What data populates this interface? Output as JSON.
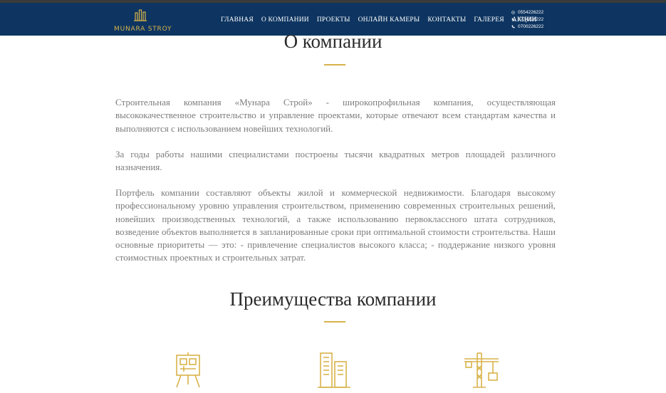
{
  "header": {
    "logo_text": "MUNARA STROY",
    "nav": [
      "ГЛАВНАЯ",
      "О КОМПАНИИ",
      "ПРОЕКТЫ",
      "ОНЛАЙН КАМЕРЫ",
      "КОНТАКТЫ",
      "ГАЛЕРЕЯ",
      "АКЦИИ"
    ],
    "phones": [
      {
        "icon": "whatsapp-icon",
        "number": "0554226222"
      },
      {
        "icon": "phone-icon",
        "number": "0774226222"
      },
      {
        "icon": "phone-icon",
        "number": "0700226222"
      }
    ]
  },
  "about": {
    "title": "О компании",
    "paragraphs": [
      "Строительная компания «Мунара Строй» - широкопрофильная компания, осуществляющая высококачественное строительство и управление проектами, которые отвечают всем стандартам качества и выполняются с использованием новейших технологий.",
      "За годы работы нашими специалистами построены тысячи квадратных метров площадей различного назначения.",
      "Портфель компании составляют объекты жилой и коммерческой недвижимости. Благодаря высокому профессиональному уровню управления строительством, применению современных строительных решений, новейших производственных технологий, а также использованию первоклассного штата сотрудников, возведение объектов выполняется в запланированные сроки при оптимальной стоимости строительства. Наши основные приоритеты — это: - привлечение специалистов высокого класса; - поддержание низкого уровня стоимостных проектных и строительных затрат."
    ]
  },
  "advantages": {
    "title": "Преимущества компании",
    "icons": [
      "blueprint-easel-icon",
      "buildings-icon",
      "crane-icon"
    ]
  },
  "colors": {
    "navbar": "#0e3561",
    "accent": "#d8b24a",
    "text": "#7c7c7c"
  }
}
